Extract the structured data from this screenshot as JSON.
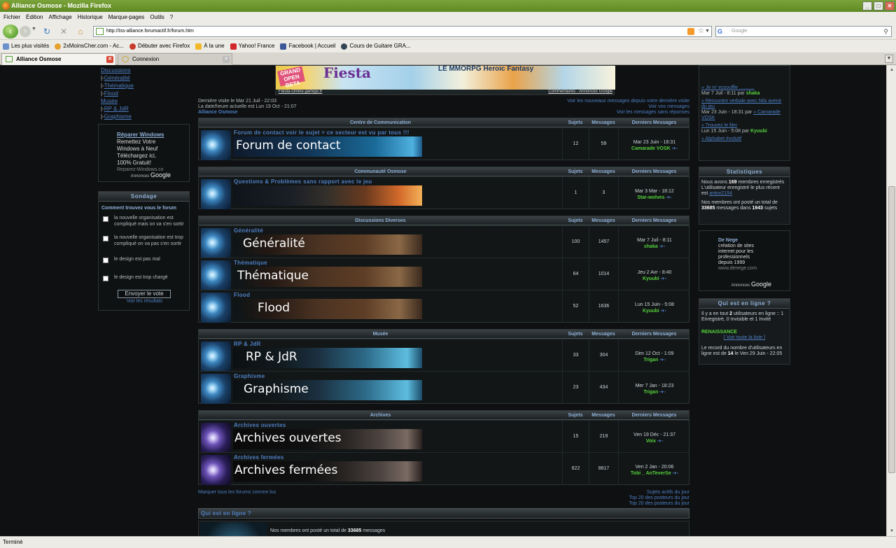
{
  "window": {
    "title": "Alliance Osmose - Mozilla Firefox",
    "min": "_",
    "max": "□",
    "close": "✕"
  },
  "menu": [
    "Fichier",
    "Édition",
    "Affichage",
    "Historique",
    "Marque-pages",
    "Outils",
    "?"
  ],
  "nav": {
    "url": "http://tss-alliance.forumactif.fr/forum.htm",
    "search_placeholder": "Google"
  },
  "bookmarks": [
    "Les plus visités",
    "2xMoinsCher.com - Ac...",
    "Débuter avec Firefox",
    "À la une",
    "Yahoo! France",
    "Facebook | Accueil",
    "Cours de Guitare GRA..."
  ],
  "tabs": [
    {
      "label": "Alliance Osmose"
    },
    {
      "label": "Connexion"
    }
  ],
  "status": "Terminé",
  "left_nav": {
    "top": "Discussions",
    "items": [
      "Généralité",
      "Thématique",
      "Flood"
    ],
    "musee": "Musée",
    "musee_items": [
      "RP & JdR",
      "Graphisme"
    ]
  },
  "ad_left": {
    "title": "Réparer Windows",
    "lines": [
      "Remettez Votre",
      "Windows à Neuf",
      "Téléchargez ici,",
      "100% Gratuit!"
    ],
    "site": "Reparez-Windows.co",
    "by": "Annonces",
    "google": "Google"
  },
  "poll": {
    "header": "Sondage",
    "question": "Comment trouvez vous le forum",
    "options": [
      "la nouvelle organisation est compliqué mais on va s'en sortir",
      "la nouvelle organisation est trop compliqué on va pas s'en sortir",
      "le design est pas mal",
      "le design est trop chargé"
    ],
    "vote": "Envoyer le vote",
    "results": "Voir les résultats"
  },
  "banner": {
    "open": "GRAND OPEN BETA",
    "logo": "Fiesta",
    "mmo": "LE MMORPG Heroic Fantasy",
    "caption_left": "Fiesta-Online.gamigo.fr",
    "caption_right": "Commentaires - Annonces Google"
  },
  "visit": {
    "last": "Dernière visite le Mar 21 Juil - 22:03",
    "now": "La date/heure actuelle est Lun 19 Oct - 21:07",
    "forum": "Alliance Osmose",
    "links": [
      "Voir les nouveaux messages depuis votre dernière visite",
      "Voir vos messages",
      "Voir les messages sans réponses"
    ]
  },
  "cols": {
    "subjects": "Sujets",
    "messages": "Messages",
    "last": "Derniers Messages"
  },
  "categories": [
    {
      "title": "Centre de Communication",
      "forums": [
        {
          "name": "Forum de contact voir le sujet = ce secteur est vu par tous !!!",
          "img": "Forum de contact",
          "subjects": "12",
          "messages": "59",
          "date": "Mar 23 Juin - 18:31",
          "user": "Camarade VOSK"
        }
      ]
    },
    {
      "title": "Communauté Osmose",
      "forums": [
        {
          "name": "Questions & Problèmes sans rapport avec le jeu",
          "img": "",
          "subjects": "1",
          "messages": "3",
          "date": "Mar 3 Mar - 18:12",
          "user": "Star-wolves"
        }
      ]
    },
    {
      "title": "Discussions Diverses",
      "forums": [
        {
          "name": "Généralité",
          "img": "Généralité",
          "subjects": "100",
          "messages": "1457",
          "date": "Mar 7 Juil - 8:11",
          "user": "shaka"
        },
        {
          "name": "Thématique",
          "img": "Thématique",
          "subjects": "64",
          "messages": "1014",
          "date": "Jeu 2 Avr - 8:40",
          "user": "Kyuubi"
        },
        {
          "name": "Flood",
          "img": "Flood",
          "subjects": "52",
          "messages": "1636",
          "date": "Lun 15 Juin - 5:08",
          "user": "Kyuubi"
        }
      ]
    },
    {
      "title": "Musée",
      "forums": [
        {
          "name": "RP & JdR",
          "img": "RP & JdR",
          "subjects": "33",
          "messages": "304",
          "date": "Dim 12 Oct - 1:09",
          "user": "Trigan"
        },
        {
          "name": "Graphisme",
          "img": "Graphisme",
          "subjects": "23",
          "messages": "434",
          "date": "Mer 7 Jan - 18:23",
          "user": "Trigan"
        }
      ]
    },
    {
      "title": "Archives",
      "forums": [
        {
          "name": "Archives ouvertes",
          "img": "Archives ouvertes",
          "subjects": "15",
          "messages": "219",
          "date": "Ven 19 Déc - 21:37",
          "user": "Voix"
        },
        {
          "name": "Archives fermées",
          "img": "Archives fermées",
          "subjects": "622",
          "messages": "8817",
          "date": "Ven 2 Jan - 20:06",
          "user": "Tobi _ AnTeverSe"
        }
      ]
    }
  ],
  "bottom": {
    "mark_read": "Marquer tous les forums comme lus",
    "right": [
      "Sujets actifs du jour",
      "Top 20 des posteurs du jour",
      "Top 20 des posteurs du jour"
    ]
  },
  "who_online": {
    "title": "Qui est en ligne ?",
    "text_pre": "Nos membres ont posté un total de",
    "count": "33685",
    "text_post": "messages"
  },
  "recent": [
    {
      "title": "Je m' essouffle ...........",
      "date": "Mar 7 Juil - 8:11 par",
      "user": "shaka"
    },
    {
      "title": "Rencontre verbale avec Nils avenir du jeu",
      "date": "Mar 23 Juin - 18:31 par",
      "user": "Camarade VOSK"
    },
    {
      "title": "Trouvez le film",
      "date": "Lun 15 Juin - 5:08 par",
      "user": "Kyuubi"
    },
    {
      "title": "Alphabet évolutif",
      "date": "",
      "user": ""
    }
  ],
  "stats": {
    "header": "Statistiques",
    "l1a": "Nous avons",
    "members": "169",
    "l1b": "membres enregistrés",
    "l2": "L'utilisateur enregistré le plus récent est",
    "newest": "antox2154",
    "l3a": "Nos membres ont posté un total de",
    "posts": "33685",
    "l3b": "messages dans",
    "topics": "1943",
    "l3c": "sujets"
  },
  "ad_right": {
    "title": "De Nege",
    "lines": [
      "création de sites",
      "internet pour les",
      "professionnels",
      "depuis 1999"
    ],
    "site": "www.denege.com",
    "by": "Annonces",
    "google": "Google"
  },
  "online_right": {
    "header": "Qui est en ligne ?",
    "l1a": "Il y a en tout",
    "total": "2",
    "l1b": "utilisateurs en ligne :: 1 Enregistré, 0 Invisible et 1 Invité",
    "user": "RENAISSANCE",
    "view": "Voir toute la liste",
    "l2a": "Le record du nombre d'utilisateurs en ligne est de",
    "record": "14",
    "l2b": "le Ven 29 Juin - 22:05"
  }
}
